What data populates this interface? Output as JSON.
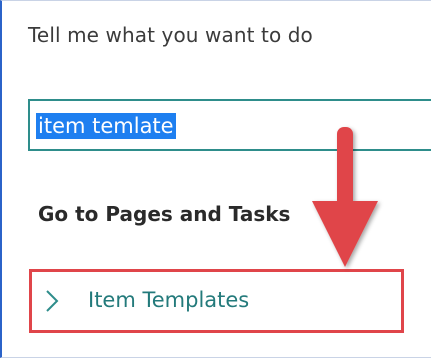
{
  "dialog": {
    "prompt": "Tell me what you want to do",
    "search": {
      "value": "item temlate"
    },
    "section_heading": "Go to Pages and Tasks",
    "results": [
      {
        "label": "Item Templates"
      }
    ]
  },
  "icons": {
    "result_chevron": "chevron-right-icon",
    "annotation": "red-down-arrow-icon"
  },
  "colors": {
    "accent_teal": "#2e8d8b",
    "selection_blue": "#1e7ff0",
    "highlight_red": "#e0454a",
    "result_text": "#237a7b"
  }
}
